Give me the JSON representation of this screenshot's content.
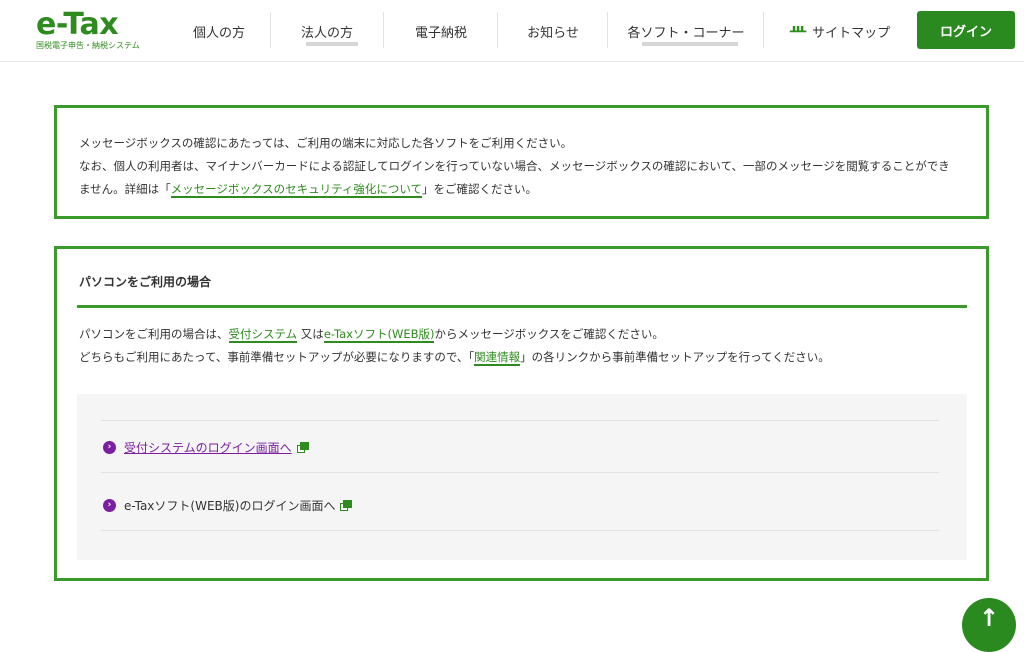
{
  "header": {
    "logo_main": "e-Tax",
    "logo_sub": "国税電子申告・納税システム",
    "nav": [
      {
        "label": "個人の方"
      },
      {
        "label": "法人の方"
      },
      {
        "label": "電子納税"
      },
      {
        "label": "お知らせ"
      },
      {
        "label": "各ソフト・コーナー"
      },
      {
        "label": "サイトマップ",
        "icon": "sitemap-icon"
      }
    ],
    "login_label": "ログイン"
  },
  "notice": {
    "line1": "メッセージボックスの確認にあたっては、ご利用の端末に対応した各ソフトをご利用ください。",
    "line2": "なお、個人の利用者は、マイナンバーカードによる認証してログインを行っていない場合、メッセージボックスの確認において、一部のメッセージを閲覧することができ",
    "line3_pre": "ません。詳細は「",
    "line3_link": "メッセージボックスのセキュリティ強化について",
    "line3_post": "」をご確認ください。"
  },
  "pc_section": {
    "heading": "パソコンをご利用の場合",
    "p1_pre": "パソコンをご利用の場合は、",
    "p1_link1": "受付システム",
    "p1_mid": " 又は",
    "p1_link2": "e-Taxソフト(WEB版)",
    "p1_post": "からメッセージボックスをご確認ください。",
    "p2_pre": "どちらもご利用にあたって、事前準備セットアップが必要になりますので、「",
    "p2_link": "関連情報",
    "p2_post": "」の各リンクから事前準備セットアップを行ってください。",
    "links": [
      {
        "label": "受付システムのログイン画面へ",
        "visited": true
      },
      {
        "label": "e-Taxソフト(WEB版)のログイン画面へ",
        "visited": false
      }
    ]
  },
  "colors": {
    "brand_green": "#2b8a1f",
    "visited_link": "#7b1fa2"
  }
}
